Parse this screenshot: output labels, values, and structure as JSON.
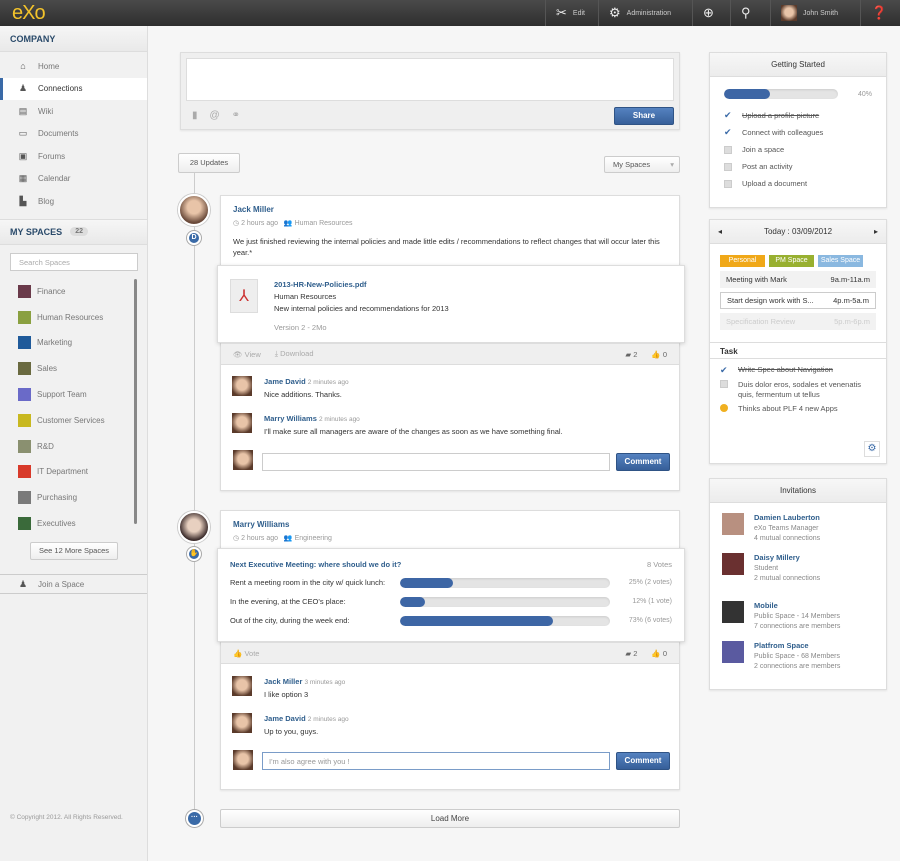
{
  "topbar": {
    "logo": "eXo",
    "edit": "Edit",
    "administration": "Administration",
    "user": "John Smith"
  },
  "sidebar": {
    "company_title": "COMPANY",
    "nav": [
      {
        "label": "Home",
        "icon": "⌂"
      },
      {
        "label": "Connections",
        "icon": "♟"
      },
      {
        "label": "Wiki",
        "icon": "▤"
      },
      {
        "label": "Documents",
        "icon": "▭"
      },
      {
        "label": "Forums",
        "icon": "▣"
      },
      {
        "label": "Calendar",
        "icon": "▦"
      },
      {
        "label": "Blog",
        "icon": "▙"
      }
    ],
    "spaces_title": "MY SPACES",
    "spaces_count": "22",
    "search_placeholder": "Search Spaces",
    "spaces": [
      {
        "label": "Finance",
        "color": "#6a3a4a"
      },
      {
        "label": "Human Resources",
        "color": "#8aa040"
      },
      {
        "label": "Marketing",
        "color": "#1f5a9a"
      },
      {
        "label": "Sales",
        "color": "#6a6a40"
      },
      {
        "label": "Support Team",
        "color": "#6a6ac8"
      },
      {
        "label": "Customer Services",
        "color": "#c8b820"
      },
      {
        "label": "R&D",
        "color": "#8a9070"
      },
      {
        "label": "IT Department",
        "color": "#d83a2a"
      },
      {
        "label": "Purchasing",
        "color": "#7a7a7a"
      },
      {
        "label": "Executives",
        "color": "#3a6a3a"
      }
    ],
    "more_spaces": "See 12 More Spaces",
    "join_space": "Join a Space",
    "copyright": "© Copyright 2012. All Rights Reserved."
  },
  "composer": {
    "share": "Share"
  },
  "stream": {
    "updates": "28 Updates",
    "filter": "My Spaces",
    "load_more": "Load More",
    "comment_label": "Comment",
    "post1": {
      "author": "Jack Miller",
      "time": "2 hours ago",
      "space": "Human Resources",
      "text": "We just finished reviewing the internal policies and made little edits / recommendations to reflect changes that will occur later this year.*",
      "file": {
        "name": "2013-HR-New-Policies.pdf",
        "space": "Human Resources",
        "desc": "New internal policies and recommendations for 2013",
        "meta": "Version 2 - 2Mo"
      },
      "view": "View",
      "download": "Download",
      "comments_count": "2",
      "likes_count": "0",
      "comments": [
        {
          "author": "Jame David",
          "time": "2 minutes ago",
          "text": "Nice additions. Thanks."
        },
        {
          "author": "Marry Williams",
          "time": "2 minutes ago",
          "text": "I'll make sure all managers are aware of the changes as soon as we have something final."
        }
      ],
      "input_value": ""
    },
    "post2": {
      "author": "Marry Williams",
      "time": "2 hours ago",
      "space": "Engineering",
      "poll": {
        "question": "Next Executive Meeting: where should we do it?",
        "total": "8 Votes",
        "options": [
          {
            "label": "Rent a meeting room in the city w/ quick lunch:",
            "percent": 25,
            "result": "25% (2 votes)"
          },
          {
            "label": "In the evening, at the CEO's place:",
            "percent": 12,
            "result": "12% (1 vote)"
          },
          {
            "label": "Out of the city, during the week end:",
            "percent": 73,
            "result": "73% (6 votes)"
          }
        ]
      },
      "vote": "Vote",
      "comments_count": "2",
      "likes_count": "0",
      "comments": [
        {
          "author": "Jack Miller",
          "time": "3 minutes ago",
          "text": "I like option 3"
        },
        {
          "author": "Jame David",
          "time": "2 minutes ago",
          "text": "Up to you, guys."
        }
      ],
      "input_value": "I'm also agree with you !"
    }
  },
  "getting_started": {
    "title": "Getting Started",
    "progress_percent": 40,
    "progress_label": "40%",
    "items": [
      {
        "label": "Upload a profile picture",
        "done": true
      },
      {
        "label": "Connect with colleagues",
        "done": true
      },
      {
        "label": "Join a space",
        "done": false
      },
      {
        "label": "Post an activity",
        "done": false
      },
      {
        "label": "Upload a document",
        "done": false
      }
    ]
  },
  "calendar": {
    "title": "Today : 03/09/2012",
    "tags": [
      {
        "label": "Personal",
        "color": "#f0a818"
      },
      {
        "label": "PM Space",
        "color": "#98b030"
      },
      {
        "label": "Sales Space",
        "color": "#8ab8e0"
      }
    ],
    "events": [
      {
        "title": "Meeting with Mark",
        "time": "9a.m-11a.m"
      },
      {
        "title": "Start design work with S...",
        "time": "4p.m-5a.m"
      },
      {
        "title": "Specification Review",
        "time": "5p.m-6p.m"
      }
    ],
    "task_title": "Task",
    "tasks": [
      {
        "label": "Write Spec about Navigation",
        "state": "done"
      },
      {
        "label": "Duis dolor eros, sodales et venenatis quis, fermentum ut tellus",
        "state": "todo"
      },
      {
        "label": "Thinks about PLF 4 new Apps",
        "state": "warn"
      }
    ]
  },
  "invitations": {
    "title": "Invitations",
    "items": [
      {
        "name": "Damien Lauberton",
        "line1": "eXo Teams Manager",
        "line2": "4 mutual connections"
      },
      {
        "name": "Daisy Millery",
        "line1": "Student",
        "line2": "2 mutual connections"
      },
      {
        "name": "Mobile",
        "line1": "Public Space - 14 Members",
        "line2": "7 connections are members"
      },
      {
        "name": "Platfrom Space",
        "line1": "Public Space - 68 Members",
        "line2": "2 connections are members"
      }
    ]
  }
}
